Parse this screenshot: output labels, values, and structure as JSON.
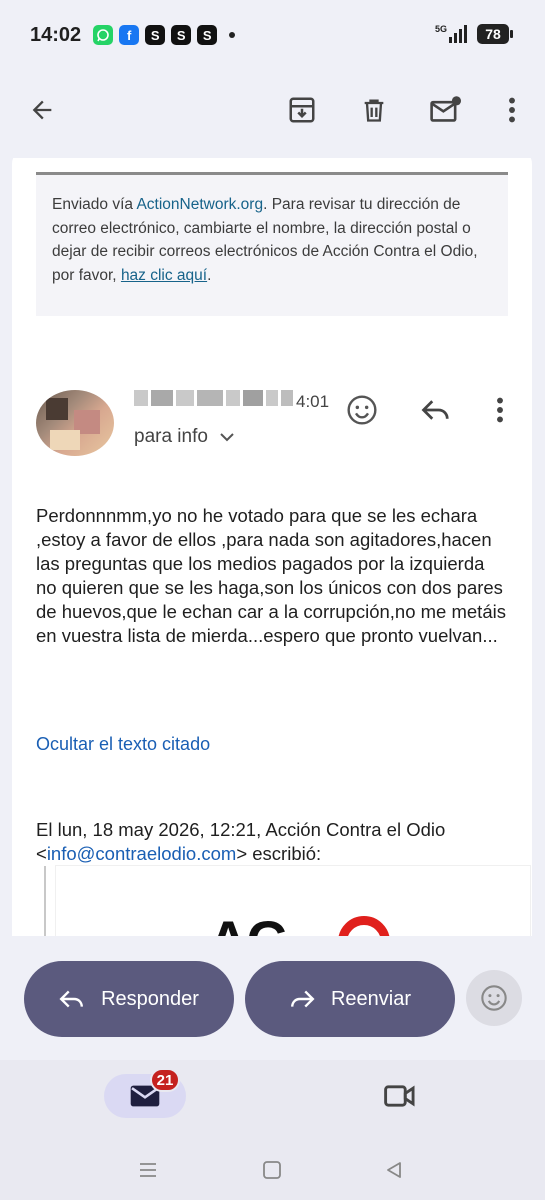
{
  "status_bar": {
    "time": "14:02",
    "battery": "78",
    "network": "5G",
    "apps": [
      {
        "name": "whatsapp-icon",
        "glyph": "✆",
        "color": "#25d366"
      },
      {
        "name": "facebook-icon",
        "glyph": "f",
        "color": "#1877f2"
      },
      {
        "name": "app-s-icon",
        "glyph": "S",
        "color": "#111111"
      },
      {
        "name": "app-s-icon",
        "glyph": "S",
        "color": "#111111"
      },
      {
        "name": "app-s-icon",
        "glyph": "S",
        "color": "#111111"
      }
    ]
  },
  "toolbar": {
    "back": "arrow-back-icon",
    "archive": "archive-icon",
    "delete": "trash-icon",
    "mark_unread": "mail-unread-icon",
    "more": "more-vert-icon"
  },
  "previous_message": {
    "footer_prefix": "Enviado vía ",
    "footer_link": "ActionNetwork.org",
    "footer_middle": ". Para revisar tu dirección de correo electrónico, cambiarte el nombre, la dirección postal o dejar de recibir correos electrónicos de Acción Contra el Odio, por favor, ",
    "footer_click": "haz clic aquí",
    "footer_end": "."
  },
  "current_message": {
    "time": "4:01",
    "recipient": "para info",
    "body": "Perdonnnmm,yo no he votado para que se les echara ,estoy a favor de ellos ,para nada son agitadores,hacen las preguntas que los medios pagados por la izquierda no quieren que se les haga,son los únicos con dos pares de huevos,que le echan car a la corrupción,no me metáis en vuestra lista de mierda...espero que pronto vuelvan...",
    "hide_quoted": "Ocultar el texto citado",
    "quote_prefix": "El lun, 18 may 2026, 12:21, Acción Contra el Odio <",
    "quote_email": "info@contraelodio.com",
    "quote_suffix": "> escribió:",
    "quote_logo": "AC"
  },
  "actions": {
    "reply": "Responder",
    "forward": "Reenviar"
  },
  "bottom_nav": {
    "mail_badge": "21"
  },
  "colors": {
    "background": "#eff0f7",
    "pill": "#5b5a7e",
    "link": "#1a5fb4",
    "badge": "#c5221f"
  }
}
